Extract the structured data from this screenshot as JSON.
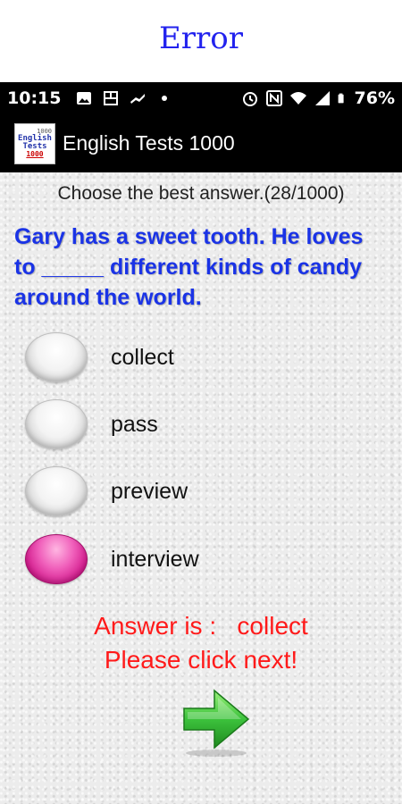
{
  "banner": {
    "text": "Error"
  },
  "status_bar": {
    "time": "10:15",
    "battery": "76%"
  },
  "app_bar": {
    "title": "English Tests 1000",
    "logo": {
      "line1": "1000",
      "line2": "English",
      "line3": "Tests",
      "line4": "1000"
    }
  },
  "quiz": {
    "instruction": "Choose the best answer.(28/1000)",
    "question": "Gary has a sweet tooth. He loves to _____ different kinds of candy around the world.",
    "options": [
      {
        "label": "collect",
        "selected": false
      },
      {
        "label": "pass",
        "selected": false
      },
      {
        "label": "preview",
        "selected": false
      },
      {
        "label": "interview",
        "selected": true
      }
    ],
    "answer_line1": "Answer is :   collect",
    "answer_line2": "Please click next!"
  },
  "colors": {
    "banner_text": "#2222ee",
    "question_text": "#1a33e6",
    "answer_text": "#ff1a1a",
    "selected_radio": "#e0309e",
    "next_arrow": "#2fb52f"
  },
  "icons": [
    "gallery-icon",
    "recent-icon",
    "fitness-icon",
    "dot-icon",
    "alarm-icon",
    "nfc-icon",
    "wifi-icon",
    "signal-icon",
    "battery-icon",
    "next-arrow-icon"
  ]
}
